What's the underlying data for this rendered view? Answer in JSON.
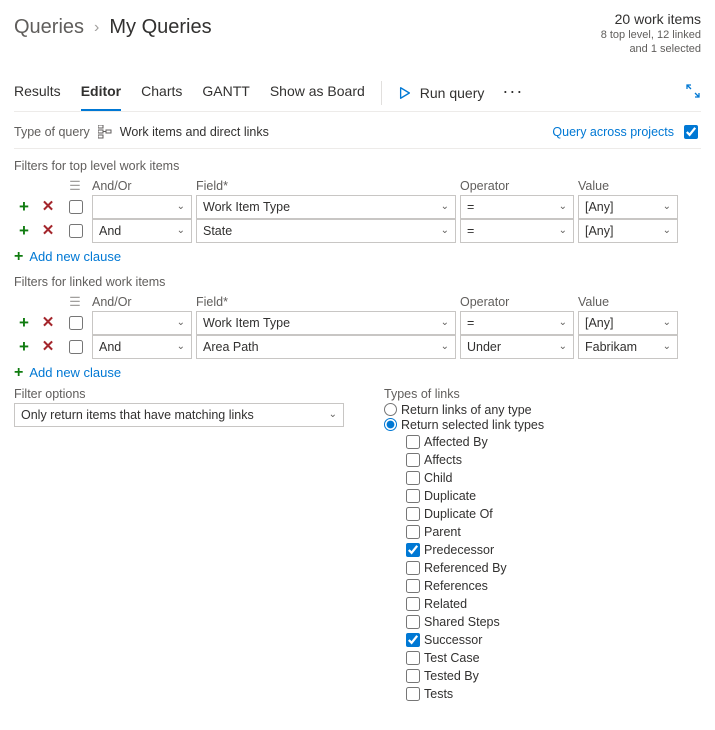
{
  "breadcrumb": {
    "root": "Queries",
    "current": "My Queries"
  },
  "stats": {
    "count_line": "20 work items",
    "detail1": "8 top level, 12 linked",
    "detail2": "and 1 selected"
  },
  "tabs": [
    "Results",
    "Editor",
    "Charts",
    "GANTT",
    "Show as Board"
  ],
  "active_tab": "Editor",
  "run_query_label": "Run query",
  "type_of_query": {
    "label": "Type of query",
    "value": "Work items and direct links"
  },
  "query_across_projects": {
    "label": "Query across projects",
    "checked": true
  },
  "top_filters_heading": "Filters for top level work items",
  "linked_filters_heading": "Filters for linked work items",
  "columns": {
    "andor": "And/Or",
    "field": "Field",
    "operator": "Operator",
    "value": "Value"
  },
  "top_filters": [
    {
      "andor": "",
      "field": "Work Item Type",
      "operator": "=",
      "value": "[Any]"
    },
    {
      "andor": "And",
      "field": "State",
      "operator": "=",
      "value": "[Any]"
    }
  ],
  "linked_filters": [
    {
      "andor": "",
      "field": "Work Item Type",
      "operator": "=",
      "value": "[Any]"
    },
    {
      "andor": "And",
      "field": "Area Path",
      "operator": "Under",
      "value": "Fabrikam"
    }
  ],
  "add_clause_label": "Add new clause",
  "filter_options": {
    "label": "Filter options",
    "selected": "Only return items that have matching links"
  },
  "link_types": {
    "label": "Types of links",
    "radio_any": "Return links of any type",
    "radio_selected": "Return selected link types",
    "radio_choice": "selected",
    "items": [
      {
        "label": "Affected By",
        "checked": false
      },
      {
        "label": "Affects",
        "checked": false
      },
      {
        "label": "Child",
        "checked": false
      },
      {
        "label": "Duplicate",
        "checked": false
      },
      {
        "label": "Duplicate Of",
        "checked": false
      },
      {
        "label": "Parent",
        "checked": false
      },
      {
        "label": "Predecessor",
        "checked": true
      },
      {
        "label": "Referenced By",
        "checked": false
      },
      {
        "label": "References",
        "checked": false
      },
      {
        "label": "Related",
        "checked": false
      },
      {
        "label": "Shared Steps",
        "checked": false
      },
      {
        "label": "Successor",
        "checked": true
      },
      {
        "label": "Test Case",
        "checked": false
      },
      {
        "label": "Tested By",
        "checked": false
      },
      {
        "label": "Tests",
        "checked": false
      }
    ]
  }
}
